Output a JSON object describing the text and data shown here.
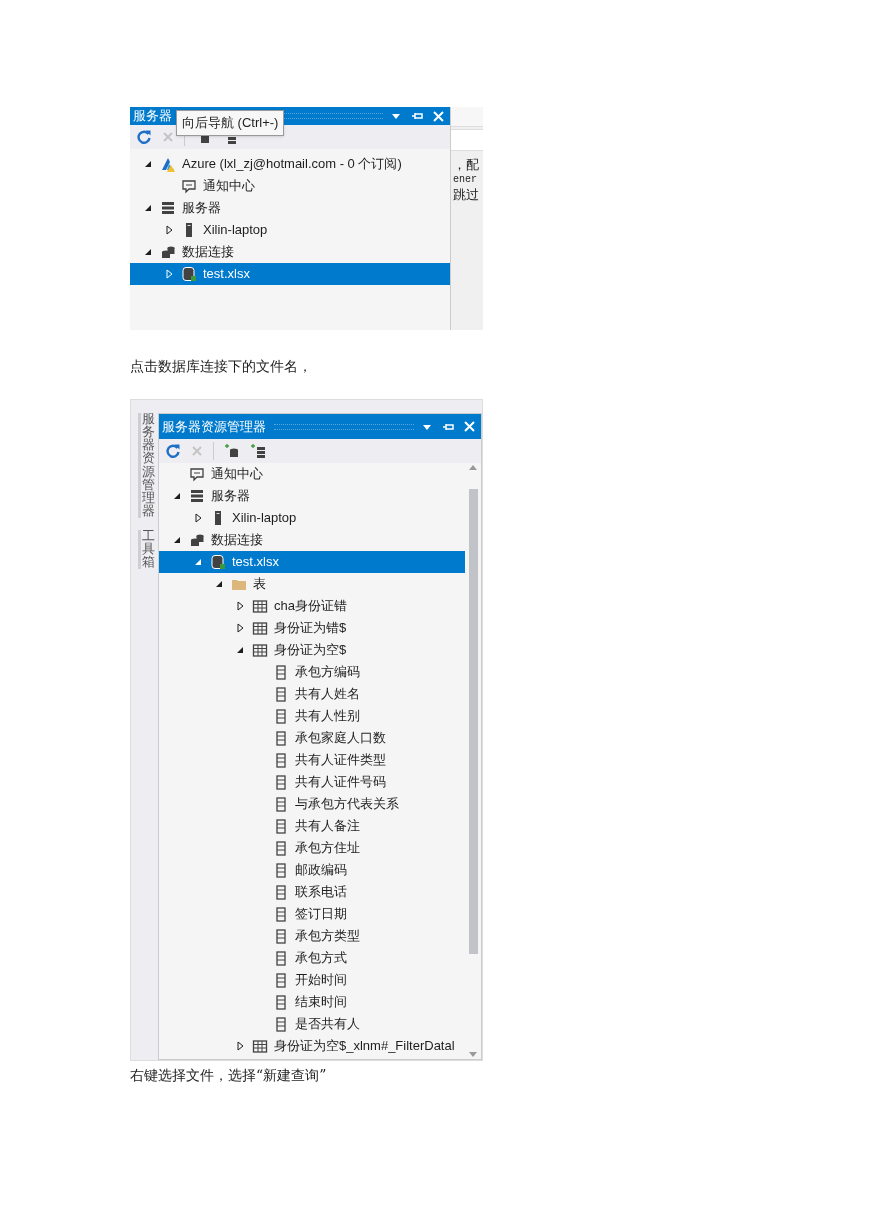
{
  "blocks": [
    {
      "kind": "screenshot",
      "title": "服务器",
      "tooltip": "向后导航 (Ctrl+-)",
      "side_texts": [
        "，配",
        "ener",
        "跳过"
      ],
      "tree": [
        {
          "kind": "azure",
          "label": "Azure (lxl_zj@hotmail.com - 0 个订阅)",
          "expanded": true,
          "selected": false,
          "children": [
            {
              "kind": "notification",
              "label": "通知中心",
              "selected": false
            }
          ]
        },
        {
          "kind": "servers",
          "label": "服务器",
          "expanded": true,
          "selected": false,
          "children": [
            {
              "kind": "computer",
              "label": "Xilin-laptop",
              "expanded": false,
              "selected": false
            }
          ]
        },
        {
          "kind": "connections",
          "label": "数据连接",
          "expanded": true,
          "selected": false,
          "children": [
            {
              "kind": "file",
              "label": "test.xlsx",
              "expanded": false,
              "selected": true
            }
          ]
        }
      ]
    },
    {
      "kind": "caption",
      "text": "点击数据库连接下的文件名，"
    },
    {
      "kind": "screenshot",
      "title": "服务器资源管理器",
      "side_tabs": [
        "服务器资源管理器",
        "工具箱"
      ],
      "tree": [
        {
          "kind": "notification",
          "label": "通知中心",
          "selected": false
        },
        {
          "kind": "servers",
          "label": "服务器",
          "expanded": true,
          "selected": false,
          "children": [
            {
              "kind": "computer",
              "label": "Xilin-laptop",
              "expanded": false,
              "selected": false
            }
          ]
        },
        {
          "kind": "connections",
          "label": "数据连接",
          "expanded": true,
          "selected": false,
          "children": [
            {
              "kind": "file",
              "label": "test.xlsx",
              "expanded": true,
              "selected": true,
              "children": [
                {
                  "kind": "folder",
                  "label": "表",
                  "expanded": true,
                  "selected": false,
                  "children": [
                    {
                      "kind": "table",
                      "label": "cha身份证错",
                      "expanded": false,
                      "selected": false
                    },
                    {
                      "kind": "table",
                      "label": "身份证为错$",
                      "expanded": false,
                      "selected": false
                    },
                    {
                      "kind": "table",
                      "label": "身份证为空$",
                      "expanded": true,
                      "selected": false,
                      "children": [
                        {
                          "kind": "column",
                          "label": "承包方编码",
                          "selected": false
                        },
                        {
                          "kind": "column",
                          "label": "共有人姓名",
                          "selected": false
                        },
                        {
                          "kind": "column",
                          "label": "共有人性别",
                          "selected": false
                        },
                        {
                          "kind": "column",
                          "label": "承包家庭人口数",
                          "selected": false
                        },
                        {
                          "kind": "column",
                          "label": "共有人证件类型",
                          "selected": false
                        },
                        {
                          "kind": "column",
                          "label": "共有人证件号码",
                          "selected": false
                        },
                        {
                          "kind": "column",
                          "label": "与承包方代表关系",
                          "selected": false
                        },
                        {
                          "kind": "column",
                          "label": "共有人备注",
                          "selected": false
                        },
                        {
                          "kind": "column",
                          "label": "承包方住址",
                          "selected": false
                        },
                        {
                          "kind": "column",
                          "label": "邮政编码",
                          "selected": false
                        },
                        {
                          "kind": "column",
                          "label": "联系电话",
                          "selected": false
                        },
                        {
                          "kind": "column",
                          "label": "签订日期",
                          "selected": false
                        },
                        {
                          "kind": "column",
                          "label": "承包方类型",
                          "selected": false
                        },
                        {
                          "kind": "column",
                          "label": "承包方式",
                          "selected": false
                        },
                        {
                          "kind": "column",
                          "label": "开始时间",
                          "selected": false
                        },
                        {
                          "kind": "column",
                          "label": "结束时间",
                          "selected": false
                        },
                        {
                          "kind": "column",
                          "label": "是否共有人",
                          "selected": false
                        }
                      ]
                    },
                    {
                      "kind": "table",
                      "label": "身份证为空$_xlnm#_FilterDatal",
                      "expanded": false,
                      "selected": false
                    }
                  ]
                }
              ]
            }
          ]
        }
      ]
    },
    {
      "kind": "caption",
      "text": "右键选择文件，选择“新建查询”"
    }
  ]
}
